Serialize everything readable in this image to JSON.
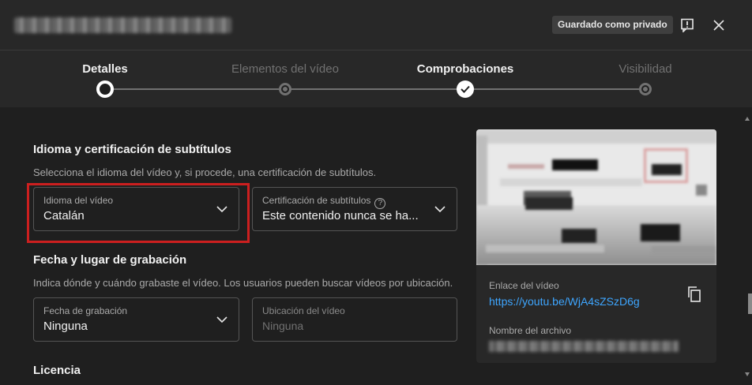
{
  "header": {
    "title": "Grabación 2025 01 14 120738",
    "status_chip": "Guardado como privado",
    "feedback_icon": "feedback-icon",
    "close_icon": "close-icon"
  },
  "stepper": {
    "steps": [
      {
        "label": "Detalles",
        "state": "current"
      },
      {
        "label": "Elementos del vídeo",
        "state": "pending"
      },
      {
        "label": "Comprobaciones",
        "state": "done"
      },
      {
        "label": "Visibilidad",
        "state": "pending"
      }
    ]
  },
  "subtitles_section": {
    "title": "Idioma y certificación de subtítulos",
    "description": "Selecciona el idioma del vídeo y, si procede, una certificación de subtítulos.",
    "language_field": {
      "label": "Idioma del vídeo",
      "value": "Catalán"
    },
    "certification_field": {
      "label": "Certificación de subtítulos",
      "value": "Este contenido nunca se ha..."
    }
  },
  "recording_section": {
    "title": "Fecha y lugar de grabación",
    "description": "Indica dónde y cuándo grabaste el vídeo. Los usuarios pueden buscar vídeos por ubicación.",
    "date_field": {
      "label": "Fecha de grabación",
      "value": "Ninguna"
    },
    "location_field": {
      "label": "Ubicación del vídeo",
      "placeholder": "Ninguna"
    }
  },
  "license_section": {
    "title": "Licencia"
  },
  "video_card": {
    "link_label": "Enlace del vídeo",
    "link": "https://youtu.be/WjA4sZSzD6g",
    "filename_label": "Nombre del archivo",
    "filename": "Grabación 2025 01 14 120738.mp4"
  },
  "colors": {
    "accent_link": "#3ea6ff",
    "highlight": "#cc1f1f",
    "background": "#1f1f1f"
  }
}
